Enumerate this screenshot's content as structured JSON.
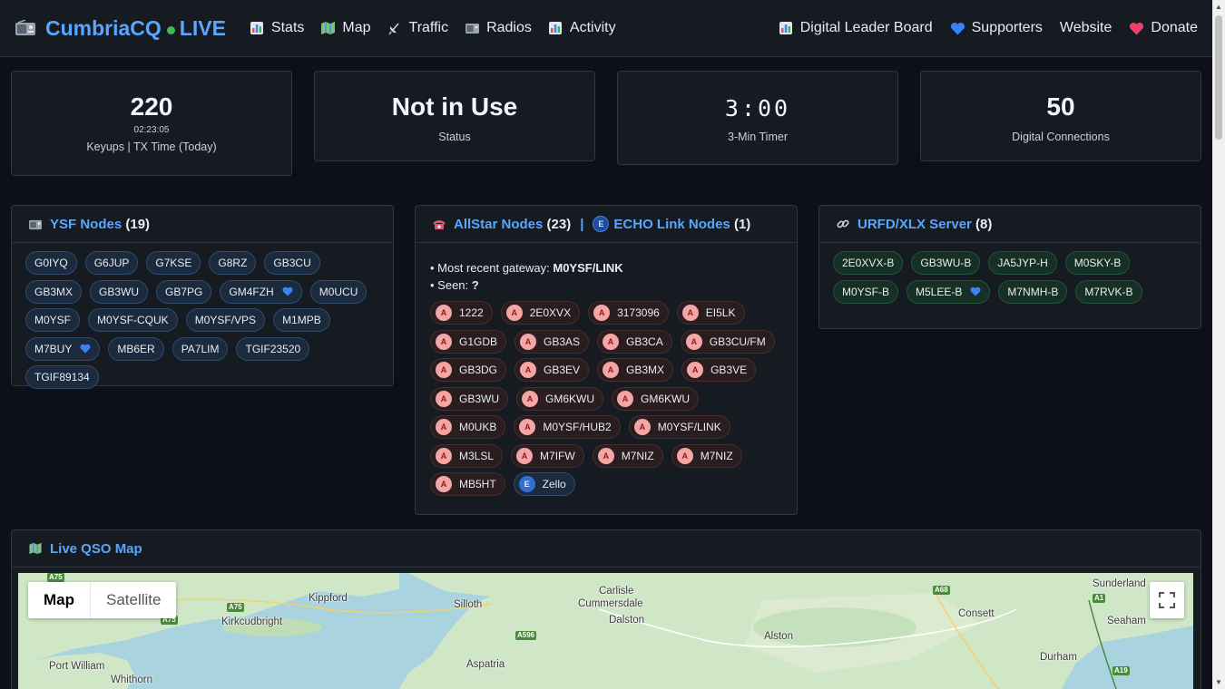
{
  "nav": {
    "brand_name": "CumbriaCQ",
    "brand_live": "LIVE",
    "left_items": [
      {
        "label": "Stats",
        "icon": "bar-chart-icon"
      },
      {
        "label": "Map",
        "icon": "map-icon"
      },
      {
        "label": "Traffic",
        "icon": "satellite-dish-icon"
      },
      {
        "label": "Radios",
        "icon": "radio-icon"
      },
      {
        "label": "Activity",
        "icon": "bar-chart-icon"
      }
    ],
    "right_items": [
      {
        "label": "Digital Leader Board",
        "icon": "bar-chart-icon"
      },
      {
        "label": "Supporters",
        "icon": "blue-heart-icon"
      },
      {
        "label": "Website",
        "icon": ""
      },
      {
        "label": "Donate",
        "icon": "red-heart-icon"
      }
    ]
  },
  "stats": {
    "keyups": {
      "value": "220",
      "sub": "02:23:05",
      "label": "Keyups | TX Time (Today)"
    },
    "status": {
      "value": "Not in Use",
      "label": "Status"
    },
    "timer": {
      "value": "3:00",
      "label": "3-Min Timer"
    },
    "connections": {
      "value": "50",
      "label": "Digital Connections"
    }
  },
  "ysf": {
    "title": "YSF Nodes",
    "count": "(19)",
    "nodes": [
      {
        "name": "G0IYQ"
      },
      {
        "name": "G6JUP"
      },
      {
        "name": "G7KSE"
      },
      {
        "name": "G8RZ"
      },
      {
        "name": "GB3CU"
      },
      {
        "name": "GB3MX"
      },
      {
        "name": "GB3WU"
      },
      {
        "name": "GB7PG"
      },
      {
        "name": "GM4FZH",
        "supporter": true
      },
      {
        "name": "M0UCU"
      },
      {
        "name": "M0YSF"
      },
      {
        "name": "M0YSF-CQUK"
      },
      {
        "name": "M0YSF/VPS"
      },
      {
        "name": "M1MPB"
      },
      {
        "name": "M7BUY",
        "supporter": true
      },
      {
        "name": "MB6ER"
      },
      {
        "name": "PA7LIM"
      },
      {
        "name": "TGIF23520"
      },
      {
        "name": "TGIF89134"
      }
    ]
  },
  "allstar": {
    "title": "AllStar Nodes",
    "count": "(23)",
    "separator": "|",
    "echo_title": "ECHO Link Nodes",
    "echo_count": "(1)",
    "gateway_label": "• Most recent gateway:",
    "gateway_value": "M0YSF/LINK",
    "seen_label": "• Seen:",
    "seen_value": "?",
    "badge_a": "A",
    "badge_e": "E",
    "nodes": [
      {
        "name": "1222",
        "type": "A"
      },
      {
        "name": "2E0XVX",
        "type": "A"
      },
      {
        "name": "3173096",
        "type": "A"
      },
      {
        "name": "EI5LK",
        "type": "A"
      },
      {
        "name": "G1GDB",
        "type": "A"
      },
      {
        "name": "GB3AS",
        "type": "A"
      },
      {
        "name": "GB3CA",
        "type": "A"
      },
      {
        "name": "GB3CU/FM",
        "type": "A"
      },
      {
        "name": "GB3DG",
        "type": "A"
      },
      {
        "name": "GB3EV",
        "type": "A"
      },
      {
        "name": "GB3MX",
        "type": "A"
      },
      {
        "name": "GB3VE",
        "type": "A"
      },
      {
        "name": "GB3WU",
        "type": "A"
      },
      {
        "name": "GM6KWU",
        "type": "A"
      },
      {
        "name": "GM6KWU",
        "type": "A"
      },
      {
        "name": "M0UKB",
        "type": "A"
      },
      {
        "name": "M0YSF/HUB2",
        "type": "A"
      },
      {
        "name": "M0YSF/LINK",
        "type": "A"
      },
      {
        "name": "M3LSL",
        "type": "A"
      },
      {
        "name": "M7IFW",
        "type": "A"
      },
      {
        "name": "M7NIZ",
        "type": "A"
      },
      {
        "name": "M7NIZ",
        "type": "A"
      },
      {
        "name": "MB5HT",
        "type": "A"
      },
      {
        "name": "Zello",
        "type": "E"
      }
    ]
  },
  "urfd": {
    "title": "URFD/XLX Server",
    "count": "(8)",
    "nodes": [
      {
        "name": "2E0XVX-B"
      },
      {
        "name": "GB3WU-B"
      },
      {
        "name": "JA5JYP-H"
      },
      {
        "name": "M0SKY-B"
      },
      {
        "name": "M0YSF-B"
      },
      {
        "name": "M5LEE-B",
        "supporter": true
      },
      {
        "name": "M7NMH-B"
      },
      {
        "name": "M7RVK-B"
      }
    ]
  },
  "qso_map": {
    "title": "Live QSO Map",
    "tabs": [
      "Map",
      "Satellite"
    ],
    "active_tab": "Map",
    "places": [
      "Kippford",
      "Kirkcudbright",
      "Silloth",
      "Carlisle",
      "Cummersdale",
      "Dalston",
      "Alston",
      "Aspatria",
      "Port William",
      "Whithorn",
      "Sunderland",
      "Consett",
      "Seaham",
      "Durham"
    ],
    "roads": [
      "A75",
      "A75",
      "A75",
      "A596",
      "A68",
      "A19",
      "A1"
    ]
  },
  "colors": {
    "background": "#0d1117",
    "panel": "#161b22",
    "accent": "#58a6ff",
    "live_dot": "#3fb950"
  }
}
